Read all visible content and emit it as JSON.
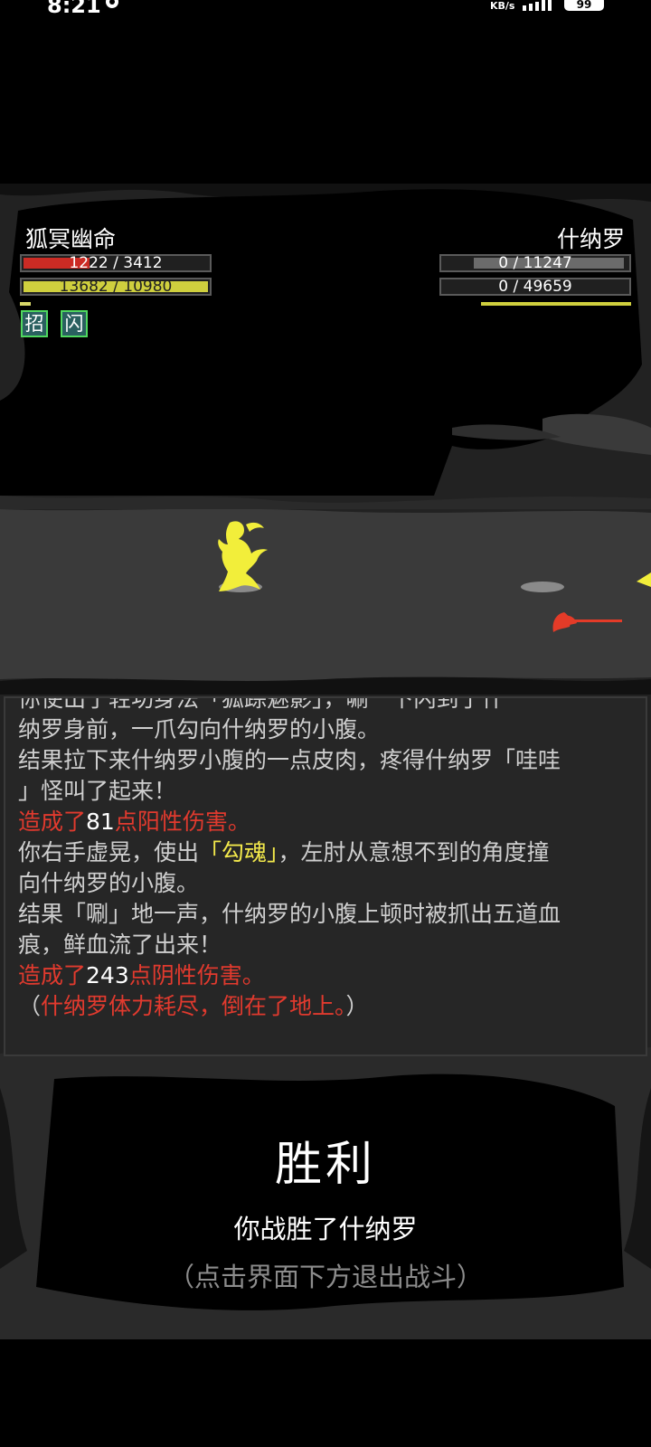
{
  "status_bar": {
    "time": "8:21",
    "icon": "settings-icon",
    "dots": "···",
    "net_speed": "KB/s",
    "battery": "99"
  },
  "player": {
    "name": "狐冥幽命",
    "hp": {
      "current": 1222,
      "max": 3412,
      "text": "1222 / 3412"
    },
    "mp": {
      "current": 13682,
      "max": 10980,
      "text": "13682 / 10980"
    },
    "skills": [
      "招",
      "闪"
    ]
  },
  "enemy": {
    "name": "什纳罗",
    "hp": {
      "current": 0,
      "max": 11247,
      "text": "0 / 11247"
    },
    "mp": {
      "current": 0,
      "max": 49659,
      "text": "0 / 49659"
    }
  },
  "log": {
    "line0": "你使出了轻功身法「狐踪魅影」，唰一下闪到了什",
    "line1": "纳罗身前，一爪勾向什纳罗的小腹。",
    "line2": "结果拉下来什纳罗小腹的一点皮肉，疼得什纳罗「哇哇",
    "line3": "」怪叫了起来！",
    "dmg1_pre": "造成了",
    "dmg1_num": "81",
    "dmg1_post": "点阳性伤害。",
    "line5_a": "你右手虚晃，使出",
    "line5_skill": "「勾魂」",
    "line5_b": "，左肘从意想不到的角度撞",
    "line6": "向什纳罗的小腹。",
    "line7": "结果「唰」地一声，什纳罗的小腹上顿时被抓出五道血",
    "line8": "痕，鲜血流了出来！",
    "dmg2_pre": "造成了",
    "dmg2_num": "243",
    "dmg2_post": "点阴性伤害。",
    "end_open": "（",
    "end_text": "什纳罗体力耗尽，倒在了地上。",
    "end_close": "）"
  },
  "victory": {
    "title": "胜利",
    "subtitle": "你战胜了什纳罗",
    "hint": "（点击界面下方退出战斗）"
  },
  "colors": {
    "hp": "#cc2b24",
    "mp": "#cfcf3e",
    "skill_border": "#4fd85f",
    "damage_text": "#e13a2e",
    "skill_name": "#f2e84b",
    "player_figure": "#f2ee3a",
    "enemy_weapon": "#e43b28"
  }
}
